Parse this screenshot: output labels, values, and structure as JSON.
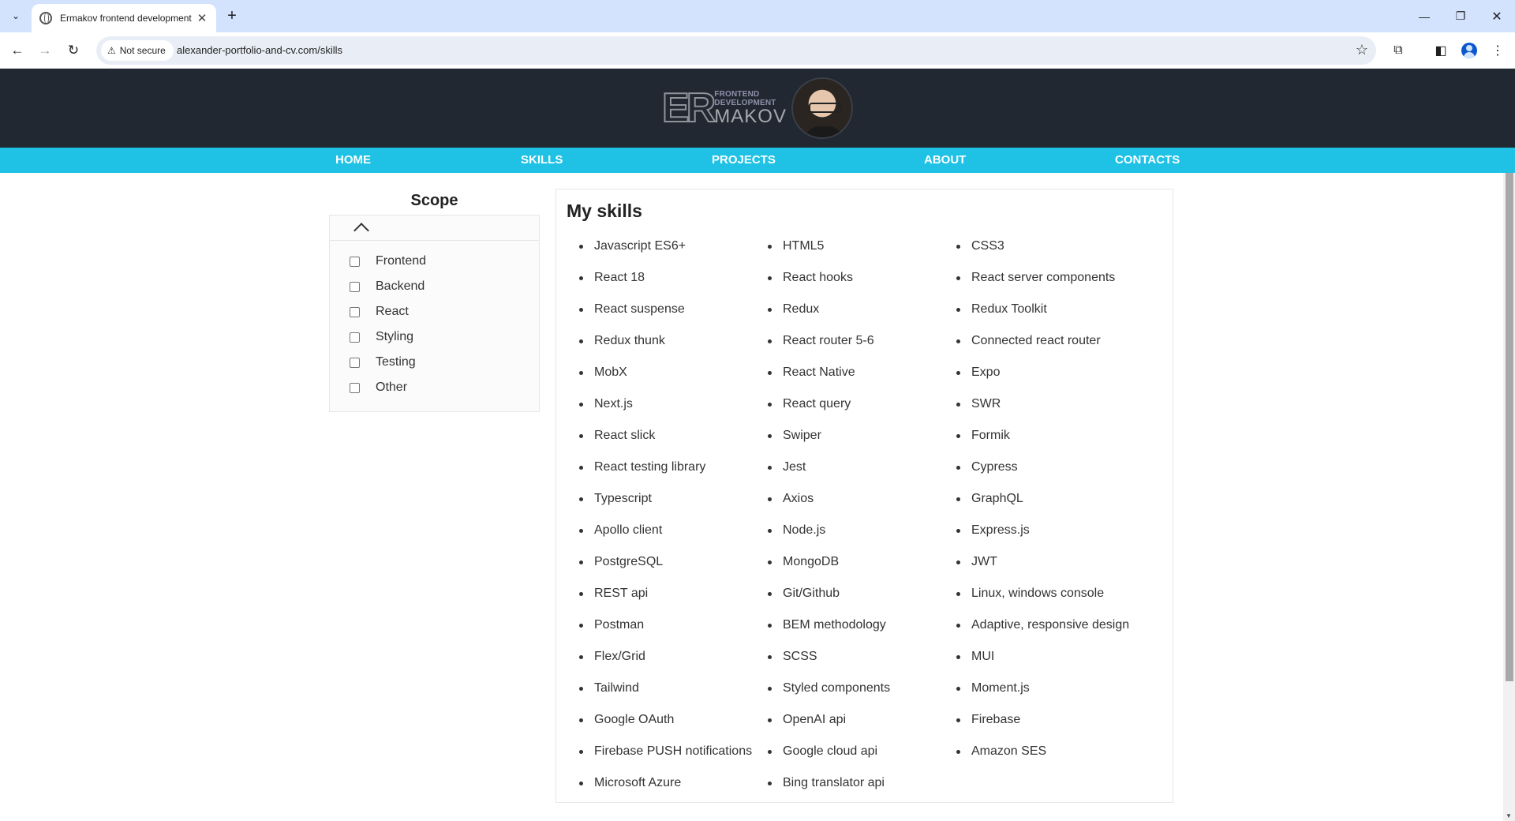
{
  "browser": {
    "tab_title": "Ermakov frontend development",
    "tab_close": "✕",
    "new_tab": "+",
    "security_label": "Not secure",
    "url": "alexander-portfolio-and-cv.com/skills"
  },
  "header": {
    "logo_letters": "ER",
    "logo_subtitle_line1": "FRONTEND",
    "logo_subtitle_line2": "DEVELOPMENT",
    "logo_name": "MAKOV"
  },
  "nav": {
    "home": "HOME",
    "skills": "SKILLS",
    "projects": "PROJECTS",
    "about": "ABOUT",
    "contacts": "CONTACTS"
  },
  "sidebar": {
    "title": "Scope",
    "filters": [
      "Frontend",
      "Backend",
      "React",
      "Styling",
      "Testing",
      "Other"
    ]
  },
  "skills": {
    "title": "My skills",
    "col1": [
      "Javascript ES6+",
      "React 18",
      "React suspense",
      "Redux thunk",
      "MobX",
      "Next.js",
      "React slick",
      "React testing library",
      "Typescript",
      "Apollo client",
      "PostgreSQL",
      "REST api",
      "Postman",
      "Flex/Grid",
      "Tailwind",
      "Google OAuth",
      "Firebase PUSH notifications",
      "Microsoft Azure"
    ],
    "col2": [
      "HTML5",
      "React hooks",
      "Redux",
      "React router 5-6",
      "React Native",
      "React query",
      "Swiper",
      "Jest",
      "Axios",
      "Node.js",
      "MongoDB",
      "Git/Github",
      "BEM methodology",
      "SCSS",
      "Styled components",
      "OpenAI api",
      "Google cloud api",
      "Bing translator api"
    ],
    "col3": [
      "CSS3",
      "React server components",
      "Redux Toolkit",
      "Connected react router",
      "Expo",
      "SWR",
      "Formik",
      "Cypress",
      "GraphQL",
      "Express.js",
      "JWT",
      "Linux, windows console",
      "Adaptive, responsive design",
      "MUI",
      "Moment.js",
      "Firebase",
      "Amazon SES"
    ]
  }
}
